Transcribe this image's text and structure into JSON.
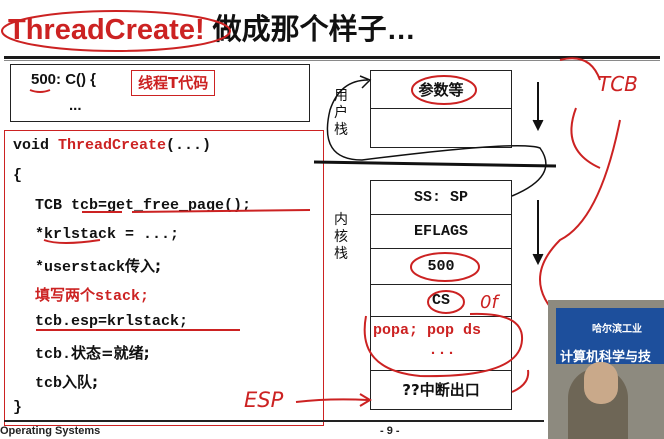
{
  "slide": {
    "title_main": "ThreadCreate!",
    "title_rest": " 做成那个样子…",
    "box1": {
      "line": "500: C() {",
      "tag": "线程T代码",
      "dots": "..."
    },
    "code": {
      "sig_prefix": "void ",
      "sig_func": "ThreadCreate",
      "sig_args": "(...)",
      "open_brace": "{",
      "line1": "TCB tcb=get_free_page();",
      "line2": "*krlstack = ...;",
      "line3_code": "*userstack",
      "line3_cjk": "传入;",
      "line4_cjk": "填写两个",
      "line4_code": "stack;",
      "line5": "tcb.esp=krlstack;",
      "line6_code": "tcb.",
      "line6_cjk": "状态=就绪;",
      "line7_code": "tcb",
      "line7_cjk": "入队;",
      "close_brace": "}"
    },
    "stack": {
      "user_label": [
        "用",
        "户",
        "栈"
      ],
      "kernel_label": [
        "内",
        "核",
        "栈"
      ],
      "user_cells": [
        "参数等",
        ""
      ],
      "kernel_cells": [
        "SS: SP",
        "EFLAGS",
        "500",
        "CS",
        "popa; pop ds",
        "...",
        "??中断出口"
      ]
    },
    "annotations": {
      "tcb": "TCB",
      "esp": "ESP",
      "of": "0f"
    },
    "footer": {
      "left": "Operating Systems",
      "page": "- 9 -"
    }
  },
  "webcam": {
    "sign_top": "哈尔滨工业",
    "sign_bottom": "计算机科学与技"
  },
  "colors": {
    "accent_red": "#cc2222",
    "text": "#111111"
  }
}
